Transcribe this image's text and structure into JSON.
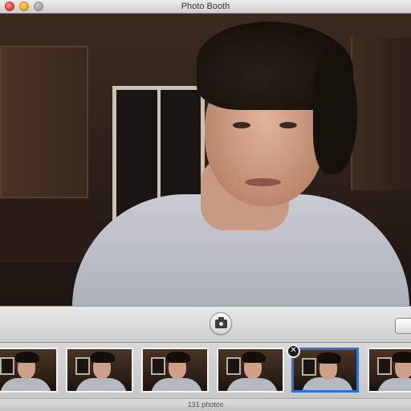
{
  "window": {
    "title": "Photo Booth"
  },
  "toolbar": {
    "shutter_icon": "camera-icon"
  },
  "filmstrip": {
    "thumbnails": [
      {
        "label": "photo"
      },
      {
        "label": "photo"
      },
      {
        "label": "photo"
      },
      {
        "label": "photo"
      },
      {
        "label": "photo",
        "selected": true
      },
      {
        "label": "photo"
      }
    ],
    "delete_symbol": "✕"
  },
  "status": {
    "photo_count": "131 photos"
  },
  "colors": {
    "selection": "#2f6fd8"
  }
}
